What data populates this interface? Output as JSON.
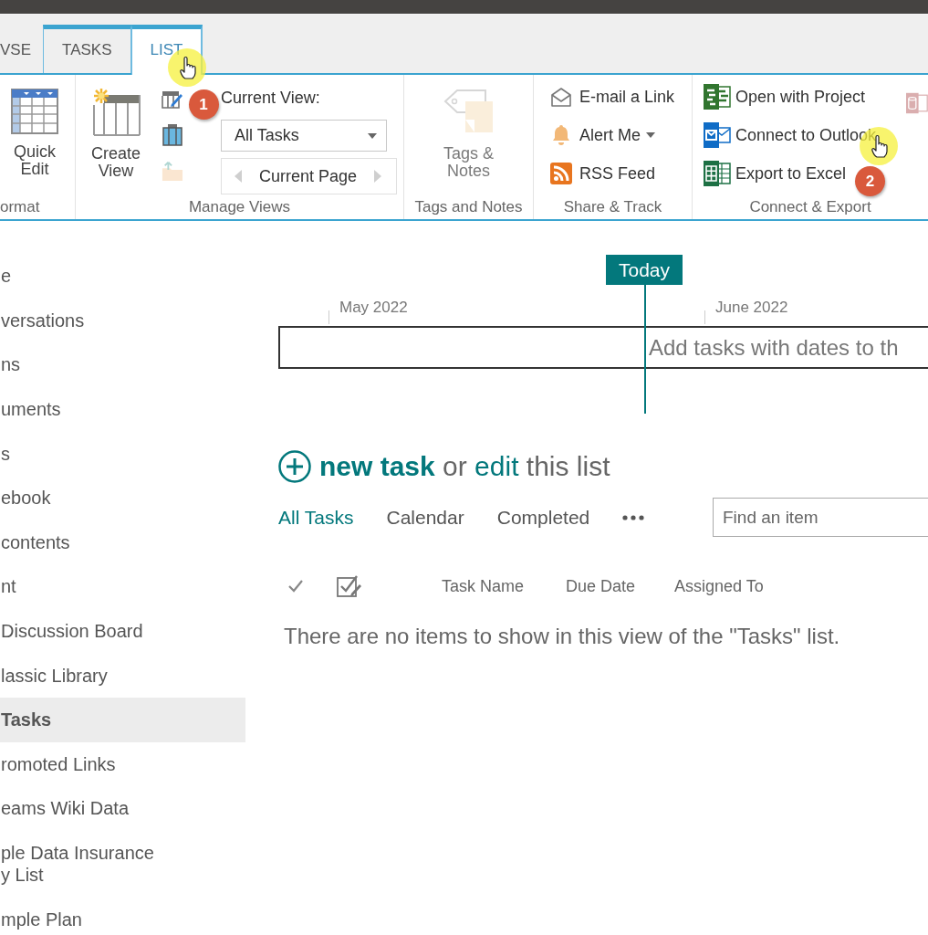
{
  "ribbon": {
    "tabs": [
      {
        "label": "VSE",
        "selected": false,
        "contextual": false,
        "pointer": false
      },
      {
        "label": "TASKS",
        "selected": false,
        "contextual": true,
        "pointer": false
      },
      {
        "label": "LIST",
        "selected": true,
        "contextual": true,
        "pointer": true,
        "callout": "1"
      }
    ],
    "groups": [
      {
        "label": "ormat",
        "columns": [
          {
            "commands": [
              {
                "kind": "large",
                "label": "Quick Edit",
                "disabled": false
              }
            ]
          }
        ]
      },
      {
        "label": "Manage Views",
        "columns": [
          {
            "commands": [
              {
                "kind": "large",
                "label": "Create View",
                "disabled": false
              }
            ]
          },
          {
            "commands": [
              {
                "kind": "icon",
                "disabled": false
              },
              {
                "kind": "icon",
                "disabled": false
              },
              {
                "kind": "icon",
                "disabled": true
              }
            ]
          },
          {
            "commands": [
              {
                "kind": "caption",
                "label": "Current View:",
                "disabled": false
              },
              {
                "kind": "dropdown",
                "value": "All Tasks",
                "disabled": false
              },
              {
                "kind": "pager",
                "label": "Current Page",
                "disabled": true
              }
            ]
          }
        ]
      },
      {
        "label": "Tags and Notes",
        "columns": [
          {
            "commands": [
              {
                "kind": "large",
                "label": "Tags & Notes",
                "disabled": true
              }
            ]
          }
        ]
      },
      {
        "label": "Share & Track",
        "columns": [
          {
            "commands": [
              {
                "kind": "small",
                "label": "E-mail a Link",
                "disabled": false,
                "menu": false
              },
              {
                "kind": "small",
                "label": "Alert Me",
                "disabled": false,
                "menu": true
              },
              {
                "kind": "small",
                "label": "RSS Feed",
                "disabled": false,
                "menu": false
              }
            ]
          }
        ]
      },
      {
        "label": "Connect & Export",
        "columns": [
          {
            "commands": [
              {
                "kind": "small",
                "label": "Open with Project",
                "disabled": false,
                "pointer": false
              },
              {
                "kind": "small",
                "label": "Connect to Outlook",
                "disabled": false,
                "pointer": true,
                "callout": "2"
              },
              {
                "kind": "small",
                "label": "Export to Excel",
                "disabled": false,
                "pointer": false
              }
            ]
          },
          {
            "commands": [
              {
                "kind": "icon",
                "disabled": true
              }
            ]
          }
        ]
      }
    ]
  },
  "sidebar": {
    "items": [
      {
        "label": "e",
        "selected": false
      },
      {
        "label": "versations",
        "selected": false
      },
      {
        "label": "ns",
        "selected": false
      },
      {
        "label": "uments",
        "selected": false
      },
      {
        "label": "s",
        "selected": false
      },
      {
        "label": "ebook",
        "selected": false
      },
      {
        "label": "contents",
        "selected": false
      },
      {
        "label": "nt",
        "selected": false
      },
      {
        "label": "Discussion Board",
        "selected": false
      },
      {
        "label": "lassic Library",
        "selected": false
      },
      {
        "label": "Tasks",
        "selected": true
      },
      {
        "label": "romoted Links",
        "selected": false
      },
      {
        "label": "eams Wiki Data",
        "selected": false
      },
      {
        "label": "ple Data Insurance\ny List",
        "selected": false
      },
      {
        "label": "mple Plan",
        "selected": false
      }
    ]
  },
  "timeline": {
    "today": "Today",
    "months": [
      "May 2022",
      "June 2022"
    ],
    "message": "Add tasks with dates to th"
  },
  "add_prompt": [
    {
      "kind": "link",
      "text": "new task",
      "bold": true
    },
    {
      "kind": "text",
      "text": "or",
      "bold": false
    },
    {
      "kind": "link",
      "text": "edit",
      "bold": false
    },
    {
      "kind": "text",
      "text": "this list",
      "bold": false
    }
  ],
  "views": [
    {
      "label": "All Tasks",
      "selected": true
    },
    {
      "label": "Calendar",
      "selected": false
    },
    {
      "label": "Completed",
      "selected": false
    }
  ],
  "search": {
    "placeholder": "Find an item"
  },
  "table": {
    "columns": [
      "Task Name",
      "Due Date",
      "Assigned To"
    ],
    "empty_message": "There are no items to show in this view of the \"Tasks\" list."
  }
}
